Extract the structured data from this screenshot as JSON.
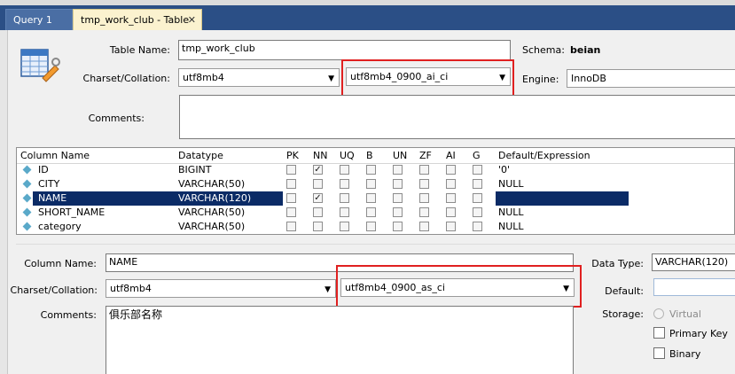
{
  "tabs": [
    {
      "label": "Query 1",
      "active": false
    },
    {
      "label": "tmp_work_club - Table",
      "active": true
    }
  ],
  "table": {
    "name_label": "Table Name:",
    "name_value": "tmp_work_club",
    "schema_label": "Schema:",
    "schema_value": "beian",
    "charset_label": "Charset/Collation:",
    "charset_value": "utf8mb4",
    "collation_value": "utf8mb4_0900_ai_ci",
    "engine_label": "Engine:",
    "engine_value": "InnoDB",
    "comments_label": "Comments:"
  },
  "grid": {
    "headers": [
      "Column Name",
      "Datatype",
      "PK",
      "NN",
      "UQ",
      "B",
      "UN",
      "ZF",
      "AI",
      "G",
      "Default/Expression"
    ],
    "rows": [
      {
        "name": "ID",
        "type": "BIGINT",
        "nn": true,
        "default": "'0'",
        "selected": false
      },
      {
        "name": "CITY",
        "type": "VARCHAR(50)",
        "nn": false,
        "default": "NULL",
        "selected": false
      },
      {
        "name": "NAME",
        "type": "VARCHAR(120)",
        "nn": true,
        "default": "",
        "selected": true
      },
      {
        "name": "SHORT_NAME",
        "type": "VARCHAR(50)",
        "nn": false,
        "default": "NULL",
        "selected": false
      },
      {
        "name": "category",
        "type": "VARCHAR(50)",
        "nn": false,
        "default": "NULL",
        "selected": false
      }
    ]
  },
  "column": {
    "name_label": "Column Name:",
    "name_value": "NAME",
    "charset_label": "Charset/Collation:",
    "charset_value": "utf8mb4",
    "collation_value": "utf8mb4_0900_as_ci",
    "comments_label": "Comments:",
    "comments_value": "俱乐部名称",
    "datatype_label": "Data Type:",
    "datatype_value": "VARCHAR(120)",
    "default_label": "Default:",
    "storage_label": "Storage:",
    "virtual_label": "Virtual",
    "primary_key_label": "Primary Key",
    "binary_label": "Binary"
  }
}
